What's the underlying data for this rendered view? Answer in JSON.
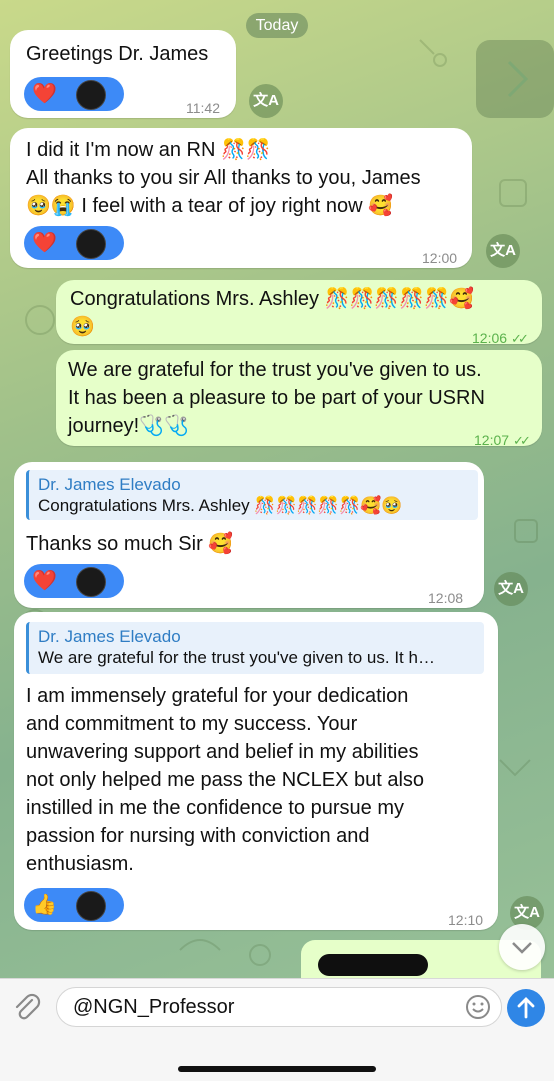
{
  "date_label": "Today",
  "messages": [
    {
      "id": "m1",
      "direction": "in",
      "text": "Greetings Dr. James",
      "time": "11:42",
      "reaction": "❤️"
    },
    {
      "id": "m2",
      "direction": "in",
      "text": "I did it I'm now an RN 🎊🎊\nAll thanks to you sir All thanks to you, James\n🥹😭 I feel with a tear of joy right now 🥰",
      "time": "12:00",
      "reaction": "❤️"
    },
    {
      "id": "m3",
      "direction": "out",
      "text": "Congratulations Mrs. Ashley 🎊🎊🎊🎊🎊🥰\n🥹",
      "time": "12:06"
    },
    {
      "id": "m4",
      "direction": "out",
      "text": "We are grateful for the trust you've given to us.\nIt has been a pleasure to be part of your USRN\njourney!🩺🩺",
      "time": "12:07"
    },
    {
      "id": "m5",
      "direction": "in",
      "reply_name": "Dr. James Elevado",
      "reply_text": "Congratulations Mrs. Ashley 🎊🎊🎊🎊🎊🥰🥹",
      "text": "Thanks so much Sir 🥰",
      "time": "12:08",
      "reaction": "❤️"
    },
    {
      "id": "m6",
      "direction": "in",
      "reply_name": "Dr. James Elevado",
      "reply_text": "We are grateful for the trust you've given to us. It h…",
      "text": "I am immensely grateful for your dedication\nand commitment to my success. Your\nunwavering support and belief in my abilities\nnot only helped me pass the NCLEX but also\ninstilled in me the confidence to pursue my\npassion for nursing with conviction and\nenthusiasm.",
      "time": "12:10",
      "reaction": "👍"
    }
  ],
  "translate_label": "文A",
  "input": {
    "value": "@NGN_Professor"
  },
  "icons": {
    "attach": "paperclip-icon",
    "emoji": "smiley-icon",
    "send": "send-arrow-icon",
    "scroll": "chevron-down-icon",
    "nav": "chevron-right-icon",
    "translate": "translate-icon"
  },
  "colors": {
    "accent": "#2f86e6",
    "outgoing": "#e6ffc9",
    "incoming": "#ffffff",
    "reaction": "#3d8af7"
  }
}
